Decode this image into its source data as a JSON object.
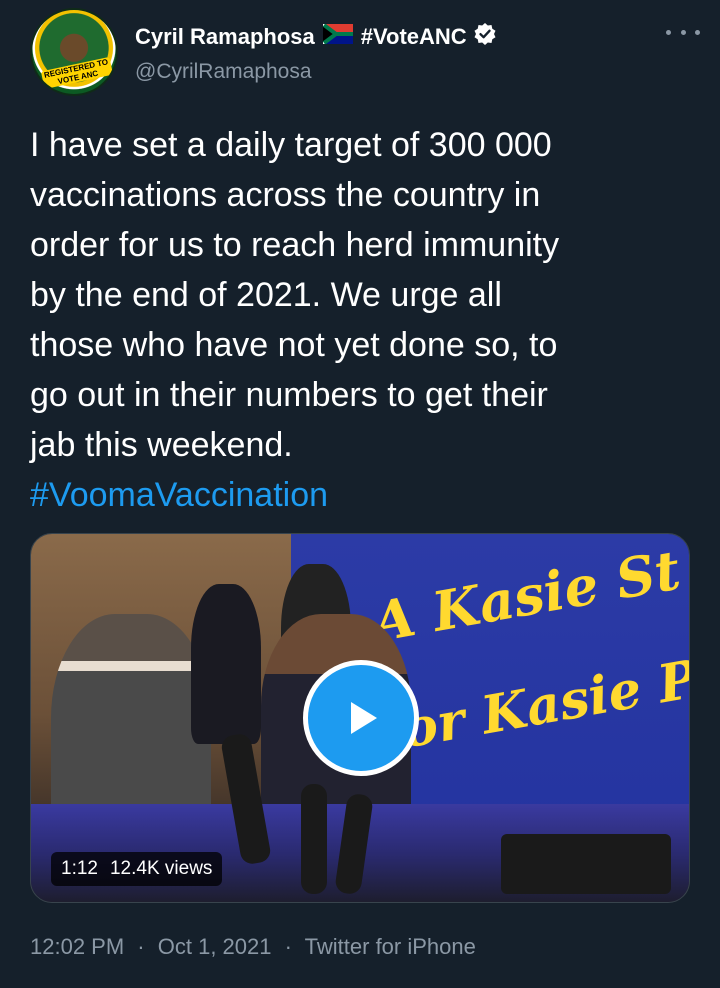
{
  "author": {
    "name": "Cyril Ramaphosa",
    "tag": "#VoteANC",
    "handle": "@CyrilRamaphosa",
    "avatar_label": "REGISTERED TO VOTE ANC",
    "verified_icon": "verified-badge-icon",
    "flag_icon": "south-africa-flag-icon"
  },
  "tweet": {
    "lines": [
      "I have set a daily target of 300 000",
      "vaccinations across the country in",
      "order for us to reach herd immunity",
      "by the end of 2021. We urge all",
      "those who have not yet done so, to",
      "go out in their numbers to get their",
      "jab this weekend."
    ],
    "hashtag": "#VoomaVaccination"
  },
  "media": {
    "type": "video",
    "duration": "1:12",
    "views": "12.4K views",
    "banner_line1": "A Kasie St",
    "banner_line2": "or Kasie P"
  },
  "meta": {
    "time": "12:02 PM",
    "date": "Oct 1, 2021",
    "source": "Twitter for iPhone",
    "separator": "·"
  },
  "colors": {
    "background": "#15202b",
    "text": "#ffffff",
    "secondary": "#8b98a5",
    "accent": "#1d9bf0"
  }
}
